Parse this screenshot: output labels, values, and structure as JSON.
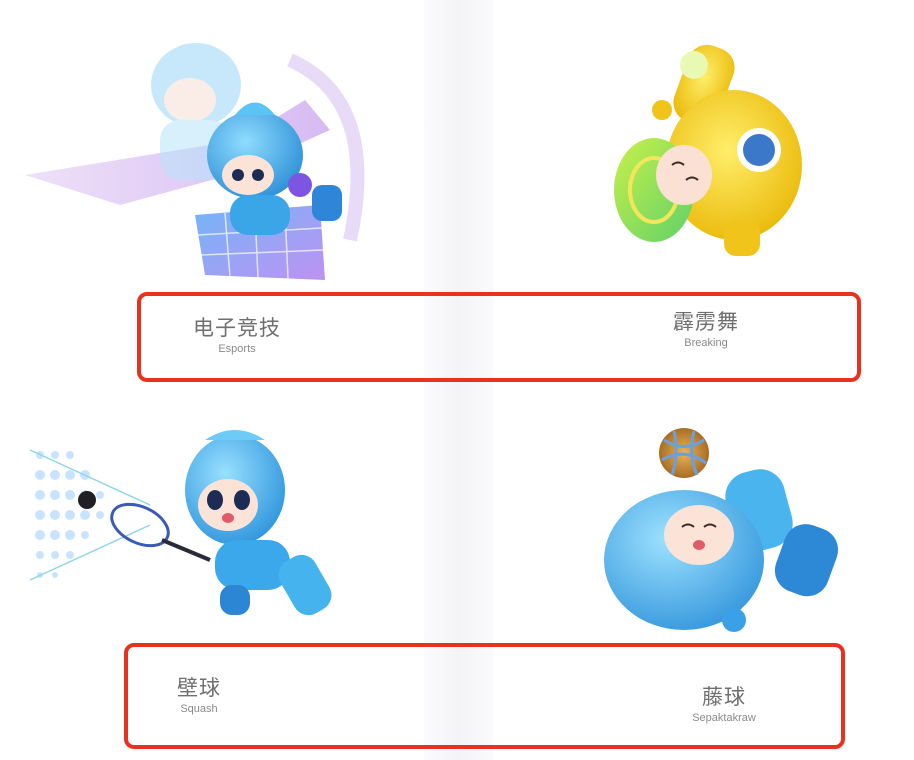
{
  "sports": [
    {
      "cn": "电子竞技",
      "en": "Esports"
    },
    {
      "cn": "霹雳舞",
      "en": "Breaking"
    },
    {
      "cn": "壁球",
      "en": "Squash"
    },
    {
      "cn": "藤球",
      "en": "Sepaktakraw"
    }
  ],
  "colors": {
    "highlight": "#e8321f",
    "mascot_blue": "#4db8f0",
    "mascot_yellow": "#f6d21e",
    "label_text": "#6f6f6f"
  }
}
